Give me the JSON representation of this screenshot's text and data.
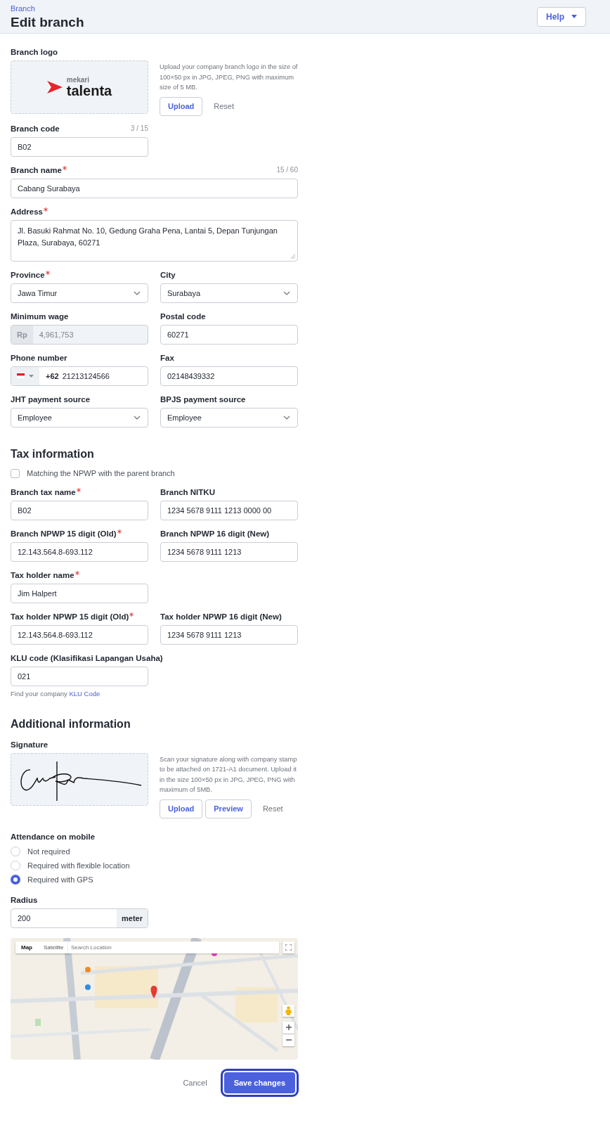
{
  "header": {
    "breadcrumb": "Branch",
    "title": "Edit branch",
    "help_button": "Help"
  },
  "logo": {
    "label": "Branch logo",
    "brand_top": "mekari",
    "brand_name": "talenta",
    "hint": "Upload your company branch logo in the size of 100×50 px in JPG, JPEG, PNG with maximum size of 5 MB.",
    "buttons": [
      {
        "label": "Upload",
        "kind": "outline"
      },
      {
        "label": "Reset",
        "kind": "ghost"
      }
    ]
  },
  "basic_rows": [
    {
      "fields": [
        {
          "kind": "text",
          "label": "Branch code",
          "required": false,
          "counter": "3 / 15",
          "value": "B02",
          "wide": false,
          "disabled": false
        }
      ]
    },
    {
      "fields": [
        {
          "kind": "text",
          "label": "Branch name",
          "required": true,
          "counter": "15 / 60",
          "value": "Cabang Surabaya",
          "wide": true,
          "disabled": false
        }
      ]
    },
    {
      "fields": [
        {
          "kind": "textarea",
          "label": "Address",
          "required": true,
          "value": "Jl. Basuki Rahmat No. 10, Gedung Graha Pena, Lantai 5, Depan Tunjungan Plaza, Surabaya, 60271",
          "wide": true,
          "disabled": false
        }
      ]
    },
    {
      "fields": [
        {
          "kind": "select",
          "label": "Province",
          "required": true,
          "value": "Jawa Timur",
          "wide": false,
          "disabled": false
        },
        {
          "kind": "select",
          "label": "City",
          "required": false,
          "value": "Surabaya",
          "wide": false,
          "disabled": false
        }
      ]
    },
    {
      "fields": [
        {
          "kind": "prefix",
          "label": "Minimum wage",
          "required": false,
          "prefix": "Rp",
          "value": "4,961,753",
          "wide": false,
          "disabled": true
        },
        {
          "kind": "text",
          "label": "Postal code",
          "required": false,
          "value": "60271",
          "wide": false,
          "disabled": false
        }
      ]
    },
    {
      "fields": [
        {
          "kind": "phone",
          "label": "Phone number",
          "required": false,
          "country_code": "+62",
          "value": "21213124566",
          "wide": false,
          "disabled": false
        },
        {
          "kind": "text",
          "label": "Fax",
          "required": false,
          "value": "02148439332",
          "wide": false,
          "disabled": false
        }
      ]
    },
    {
      "fields": [
        {
          "kind": "select",
          "label": "JHT payment source",
          "required": false,
          "value": "Employee",
          "wide": false,
          "disabled": false
        },
        {
          "kind": "select",
          "label": "BPJS payment source",
          "required": false,
          "value": "Employee",
          "wide": false,
          "disabled": false
        }
      ]
    }
  ],
  "tax": {
    "heading": "Tax information",
    "checkbox": {
      "label": "Matching the NPWP with the parent branch",
      "checked": false
    },
    "rows": [
      {
        "fields": [
          {
            "kind": "text",
            "label": "Branch tax name",
            "required": true,
            "value": "B02",
            "wide": false,
            "disabled": false
          },
          {
            "kind": "text",
            "label": "Branch NITKU",
            "required": false,
            "value": "1234 5678 9111 1213 0000 00",
            "wide": false,
            "disabled": false
          }
        ]
      },
      {
        "fields": [
          {
            "kind": "text",
            "label": "Branch NPWP 15 digit (Old)",
            "required": true,
            "value": "12.143.564.8-693.112",
            "wide": false,
            "disabled": false
          },
          {
            "kind": "text",
            "label": "Branch NPWP 16 digit (New)",
            "required": false,
            "value": "1234 5678 9111 1213",
            "wide": false,
            "disabled": false
          }
        ]
      },
      {
        "fields": [
          {
            "kind": "text",
            "label": "Tax holder name",
            "required": true,
            "value": "Jim Halpert",
            "wide": false,
            "disabled": false
          }
        ]
      },
      {
        "fields": [
          {
            "kind": "text",
            "label": "Tax holder NPWP 15 digit (Old)",
            "required": true,
            "value": "12.143.564.8-693.112",
            "wide": false,
            "disabled": false
          },
          {
            "kind": "text",
            "label": "Tax holder NPWP 16 digit (New)",
            "required": false,
            "value": "1234 5678 9111 1213",
            "wide": false,
            "disabled": false
          }
        ]
      },
      {
        "fields": [
          {
            "kind": "text",
            "label": "KLU code (Klasifikasi Lapangan Usaha)",
            "required": false,
            "value": "021",
            "wide": false,
            "disabled": false,
            "hint": "Find your company",
            "hint_link": "KLU Code"
          }
        ]
      }
    ]
  },
  "additional": {
    "heading": "Additional information",
    "signature": {
      "label": "Signature",
      "hint": "Scan your signature along with company stamp to be attached on 1721-A1 document. Upload it in the size 100×50 px in JPG, JPEG, PNG with maximum of 5MB.",
      "buttons": [
        {
          "label": "Upload",
          "kind": "outline"
        },
        {
          "label": "Preview",
          "kind": "outline"
        },
        {
          "label": "Reset",
          "kind": "ghost"
        }
      ]
    },
    "attendance": {
      "label": "Attendance on mobile",
      "options": [
        {
          "label": "Not required",
          "selected": false
        },
        {
          "label": "Required with flexible location",
          "selected": false
        },
        {
          "label": "Required with GPS",
          "selected": true
        }
      ]
    },
    "radius": {
      "label": "Radius",
      "value": "200",
      "suffix": "meter"
    },
    "map": {
      "kind": "picture",
      "tabs": [
        {
          "label": "Map",
          "selected": true
        },
        {
          "label": "Satellite",
          "selected": false
        }
      ],
      "search_placeholder": "Search Location"
    }
  },
  "footer": {
    "cancel": "Cancel",
    "save": "Save changes"
  }
}
